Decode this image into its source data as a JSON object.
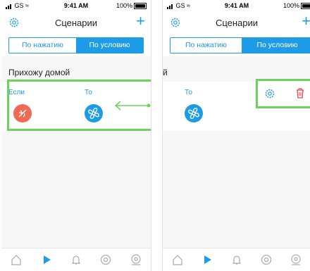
{
  "status_bar": {
    "carrier": "GS",
    "time": "9:41 AM",
    "battery": "100%"
  },
  "header": {
    "title": "Сценарии",
    "plus": "+"
  },
  "segment": {
    "left_label": "По нажатию",
    "right_label": "По условию",
    "selected": "right"
  },
  "scene": {
    "name": "Прихожу домой",
    "name_cut": "й",
    "if_label": "Если",
    "then_label": "То"
  },
  "colors": {
    "accent": "#1e9be6",
    "if_circle": "#ef6a55",
    "then_circle": "#1e9be6",
    "highlight": "#6ad35a",
    "delete": "#e54848"
  },
  "tabs": [
    "home-icon",
    "play-icon",
    "bell-icon",
    "camera-icon",
    "profile-icon"
  ],
  "actions": [
    "gear-icon",
    "trash-icon"
  ]
}
